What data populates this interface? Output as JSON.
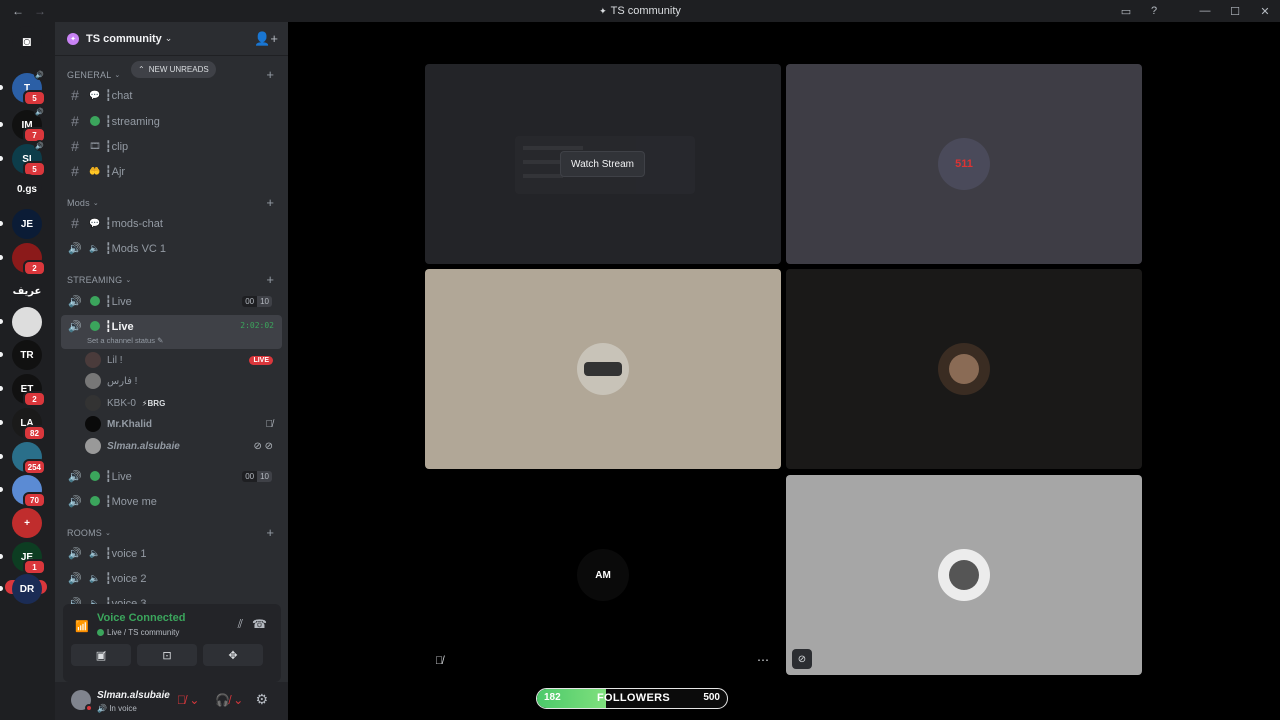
{
  "titlebar": {
    "title": "TS community"
  },
  "rail": {
    "servers": [
      {
        "label": "T",
        "badge": "5",
        "color": "#2b5fa6"
      },
      {
        "label": "IM",
        "badge": "7",
        "color": "#111"
      },
      {
        "label": "SI",
        "badge": "5",
        "color": "#0d3d4a"
      },
      {
        "label": "0.gs",
        "badge": "",
        "color": "#1e1f22"
      },
      {
        "label": "JE",
        "badge": "",
        "color": "#0b1c36"
      },
      {
        "label": "",
        "badge": "2",
        "color": "#8b1a1a"
      },
      {
        "label": "عريف",
        "badge": "",
        "color": "#1e1f22"
      },
      {
        "label": "",
        "badge": "",
        "color": "#ddd"
      },
      {
        "label": "TR",
        "badge": "",
        "color": "#111"
      },
      {
        "label": "ET",
        "badge": "2",
        "color": "#111"
      },
      {
        "label": "LA",
        "badge": "82",
        "color": "#1a1a1a"
      },
      {
        "label": "",
        "badge": "254",
        "color": "#2a6f8a"
      },
      {
        "label": "",
        "badge": "70",
        "color": "#5b8bd4"
      },
      {
        "label": "+",
        "badge": "",
        "color": "#c02d2d"
      },
      {
        "label": "JE",
        "badge": "1",
        "color": "#0d3d22"
      },
      {
        "label": "DR",
        "badge": "",
        "color": "#1b2c55"
      }
    ],
    "new_label": "NEW"
  },
  "sidebar": {
    "guild_name": "TS community",
    "new_unreads": "NEW UNREADS",
    "categories": {
      "general": "GENERAL",
      "mods": "Mods",
      "streaming": "STREAMING",
      "rooms": "ROOMS"
    },
    "channels": {
      "chat": "┇chat",
      "streaming": "┇streaming",
      "clip": "┇clip",
      "ajr": "┇Ajr",
      "mods_chat": "┇mods-chat",
      "mods_vc": "┇Mods VC 1",
      "live1": "┇Live",
      "live2": "┇Live",
      "live3": "┇Live",
      "move_me": "┇Move me",
      "voice1": "┇voice 1",
      "voice2": "┇voice 2",
      "voice3": "┇voice 3"
    },
    "live1_counts": [
      "00",
      "10"
    ],
    "live3_counts": [
      "00",
      "10"
    ],
    "live_timer": "2:02:02",
    "channel_status": "Set a channel status",
    "voice_users": [
      {
        "name": "Lil !",
        "extra": "LIVE"
      },
      {
        "name": "فارس !",
        "extra": ""
      },
      {
        "name": "KBK-0",
        "extra": "⚡BRG"
      },
      {
        "name": "Mr.Khalid",
        "extra": ""
      },
      {
        "name": "Slman.alsubaie",
        "extra": ""
      }
    ]
  },
  "voice_panel": {
    "title": "Voice Connected",
    "subtitle": "Live / TS community"
  },
  "user_panel": {
    "name": "Slman.alsubaie",
    "status": "In voice"
  },
  "stage": {
    "watch_stream": "Watch Stream",
    "tile4_avatar_label": "AM"
  },
  "followers": {
    "current": "182",
    "label": "FOLLOWERS",
    "goal": "500",
    "progress": 0.364
  }
}
